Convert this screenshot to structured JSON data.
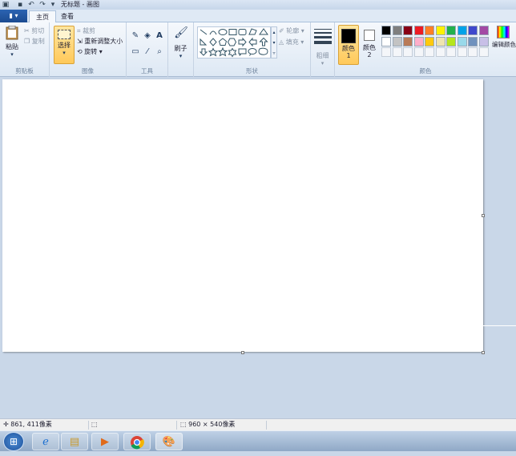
{
  "window": {
    "title": "无标题 - 画图"
  },
  "tabs": {
    "file": "▮ ▾",
    "home": "主页",
    "view": "查看"
  },
  "clipboard": {
    "paste": "粘贴",
    "cut": "剪切",
    "copy": "复制",
    "label": "剪贴板"
  },
  "image": {
    "select": "选择",
    "crop": "裁剪",
    "resize": "重新调整大小",
    "rotate": "旋转",
    "label": "图像"
  },
  "tools": {
    "label": "工具"
  },
  "brushes": {
    "label": "刷子"
  },
  "shapes": {
    "outline": "轮廓",
    "fill": "填充",
    "label": "形状"
  },
  "size": {
    "label": "粗细"
  },
  "colors": {
    "color1_label": "颜色 1",
    "color2_label": "颜色 2",
    "edit_label": "编辑颜色",
    "label": "颜色",
    "color1": "#000000",
    "color2": "#ffffff",
    "palette": [
      "#000000",
      "#7f7f7f",
      "#880015",
      "#ed1c24",
      "#ff7f27",
      "#fff200",
      "#22b14c",
      "#00a2e8",
      "#3f48cc",
      "#a349a4",
      "#ffffff",
      "#c3c3c3",
      "#b97a57",
      "#ffaec9",
      "#ffc90e",
      "#efe4b0",
      "#b5e61d",
      "#99d9ea",
      "#7092be",
      "#c8bfe7"
    ]
  },
  "status": {
    "cursor_pos": "861, 411像素",
    "selection_size": "",
    "canvas_size": "960 × 540像素"
  },
  "taskbar": {
    "items": [
      "start",
      "ie",
      "explorer",
      "media",
      "chrome",
      "paint"
    ]
  }
}
